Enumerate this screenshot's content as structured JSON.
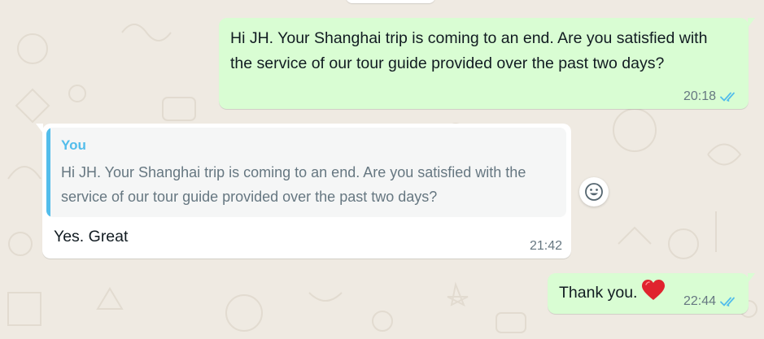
{
  "colors": {
    "background": "#efeae2",
    "outgoing_bubble": "#d9fdd3",
    "incoming_bubble": "#ffffff",
    "quote_accent": "#53bdeb",
    "read_ticks": "#53bdeb",
    "heart": "#e0242e"
  },
  "messages": [
    {
      "direction": "outgoing",
      "text": "Hi JH. Your Shanghai trip is coming to an end. Are you satisfied with the service of our tour guide provided over the past two days?",
      "time": "20:18",
      "status": "read"
    },
    {
      "direction": "incoming",
      "quote": {
        "author": "You",
        "text": "Hi JH. Your Shanghai trip is coming to an end. Are you satisfied with the service of our tour guide provided over the past two days?"
      },
      "text": "Yes. Great",
      "time": "21:42",
      "reaction_button_icon": "smiley-icon"
    },
    {
      "direction": "outgoing",
      "text": "Thank you.",
      "emoji": "red-heart",
      "time": "22:44",
      "status": "read"
    }
  ]
}
